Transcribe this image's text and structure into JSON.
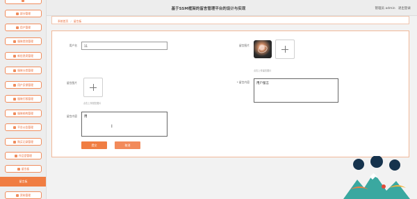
{
  "header": {
    "title": "基于SSM框架的留言管理平台的设计与实现",
    "user_label": "管理员 admin",
    "logout_label": "退出登录"
  },
  "sidebar": {
    "items": [
      {
        "label": "",
        "icon": "menu-icon"
      },
      {
        "label": "部分管理",
        "icon": "menu-icon"
      },
      {
        "label": "用户管理",
        "icon": "menu-icon"
      },
      {
        "label": "服装类别管理",
        "icon": "menu-icon"
      },
      {
        "label": "新信息类管理",
        "icon": "menu-icon"
      },
      {
        "label": "服装分类管理",
        "icon": "menu-icon"
      },
      {
        "label": "用户反馈管理",
        "icon": "menu-icon"
      },
      {
        "label": "服装打版管理",
        "icon": "menu-icon"
      },
      {
        "label": "服装结构管理",
        "icon": "menu-icon"
      },
      {
        "label": "平台公告管理",
        "icon": "menu-icon"
      },
      {
        "label": "购买记录管理",
        "icon": "menu-icon"
      },
      {
        "label": "作品室管理",
        "icon": "menu-icon"
      },
      {
        "label": "留言板",
        "icon": "menu-icon"
      }
    ],
    "active_label": "留言板",
    "bottom_item": {
      "label": "资料管理",
      "icon": "menu-icon"
    }
  },
  "breadcrumb": {
    "home": "系统首页",
    "current": "留言板"
  },
  "form": {
    "username_label": "用户名",
    "username_value": "11",
    "avatar_label": "留言图片",
    "avatar_hint": "点击上传留言图片",
    "reply_image_label": "留言图片",
    "reply_image_hint": "点击上传回复图片",
    "reply_content_label": "* 留言内容",
    "reply_content_value": "用户留言",
    "message_label": "留言内容",
    "message_value": "用",
    "submit_label": "提交",
    "cancel_label": "取消"
  }
}
